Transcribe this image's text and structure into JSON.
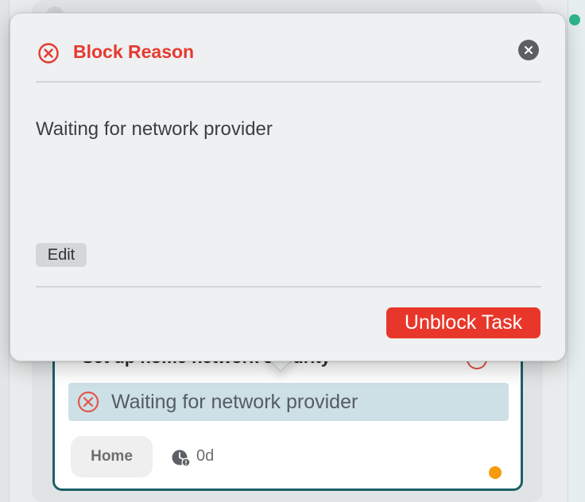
{
  "popover": {
    "title": "Block Reason",
    "reason": "Waiting for network provider",
    "edit_label": "Edit",
    "unblock_label": "Unblock Task"
  },
  "task": {
    "title": "Set up home network security",
    "block_reason": "Waiting for network provider",
    "tag": "Home",
    "age": "0d"
  },
  "icons": {
    "block": "x-circle-icon",
    "close": "close-icon",
    "age": "clock-icon"
  },
  "colors": {
    "danger": "#e53a2f",
    "card_border": "#1d5f68",
    "priority": "#f59b0e",
    "banner_bg": "#cde0e6"
  }
}
